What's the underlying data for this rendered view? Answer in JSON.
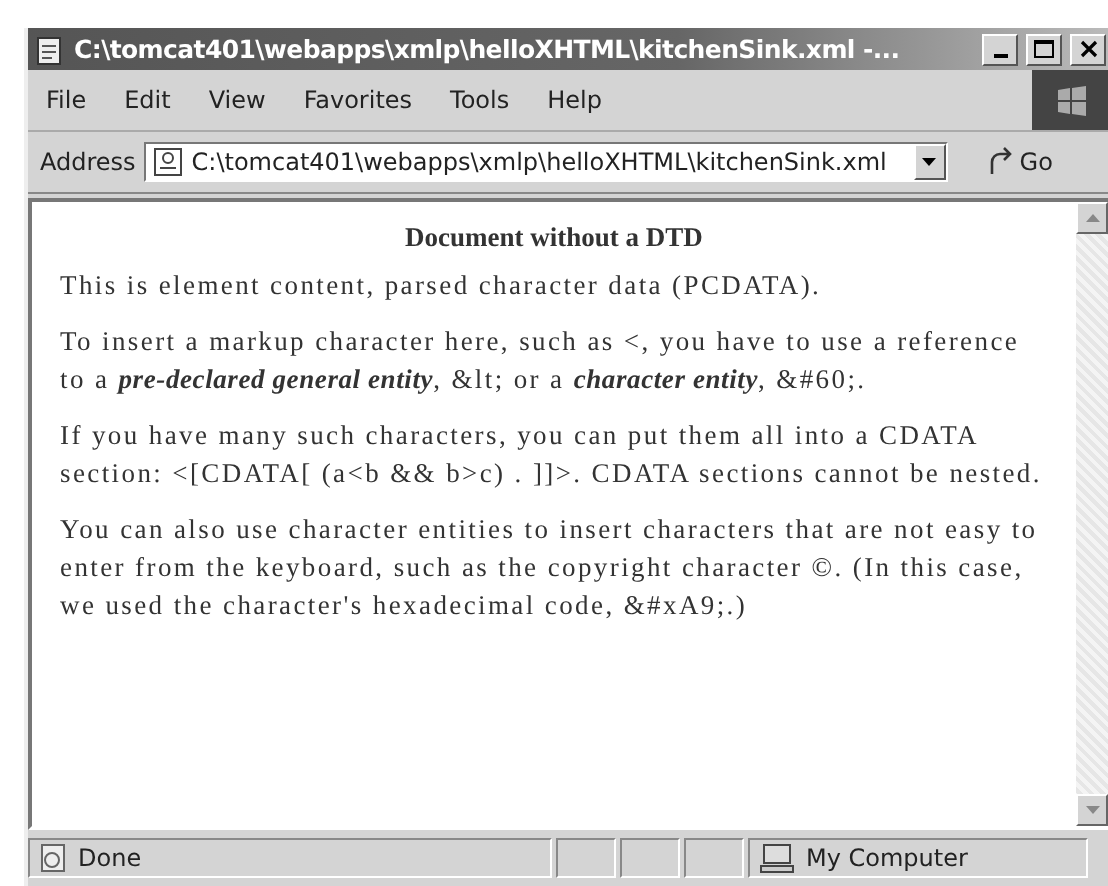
{
  "window": {
    "title": "C:\\tomcat401\\webapps\\xmlp\\helloXHTML\\kitchenSink.xml -..."
  },
  "menu": [
    "File",
    "Edit",
    "View",
    "Favorites",
    "Tools",
    "Help"
  ],
  "address": {
    "label": "Address",
    "value": "C:\\tomcat401\\webapps\\xmlp\\helloXHTML\\kitchenSink.xml",
    "go": "Go"
  },
  "document": {
    "heading": "Document without a DTD",
    "paragraphs": [
      "This is element content, parsed character data (PCDATA).",
      "To insert a markup character here, such as <, you have to use a reference to a **pre-declared general entity**, &lt; or a **character entity**, &#60;.",
      "If you have many such characters, you can put them all into a CDATA section: <[CDATA[ (a<b && b>c) . ]]>. CDATA sections cannot be nested.",
      "You can also use character entities to insert characters that are not easy to enter from the keyboard, such as the copyright character ©. (In this case, we used the character's hexadecimal code, &#xA9;.)"
    ]
  },
  "status_bar": {
    "text": "Done",
    "zone": "My Computer"
  }
}
